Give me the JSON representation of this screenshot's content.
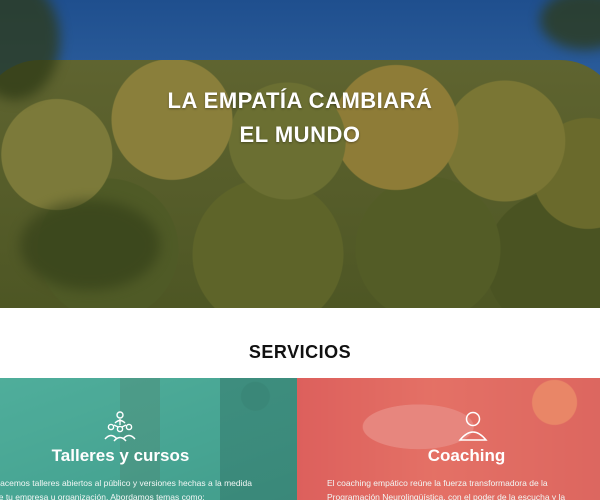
{
  "hero": {
    "title_line1": "LA EMPATÍA CAMBIARÁ",
    "title_line2": "EL MUNDO"
  },
  "services": {
    "heading": "SERVICIOS",
    "cards": [
      {
        "icon": "people-network-icon",
        "title": "Talleres y cursos",
        "text_line1": "Hacemos talleres abiertos al público y versiones hechas a la medida",
        "text_line2": "de tu empresa u organización. Abordamos temas como:",
        "color": "#4fa898"
      },
      {
        "icon": "user-icon",
        "title": "Coaching",
        "text_line1": "El coaching empático reúne la fuerza transformadora de la",
        "text_line2": "Programación Neurolingüística, con el poder de la escucha y la",
        "color": "#e06f66"
      }
    ]
  }
}
